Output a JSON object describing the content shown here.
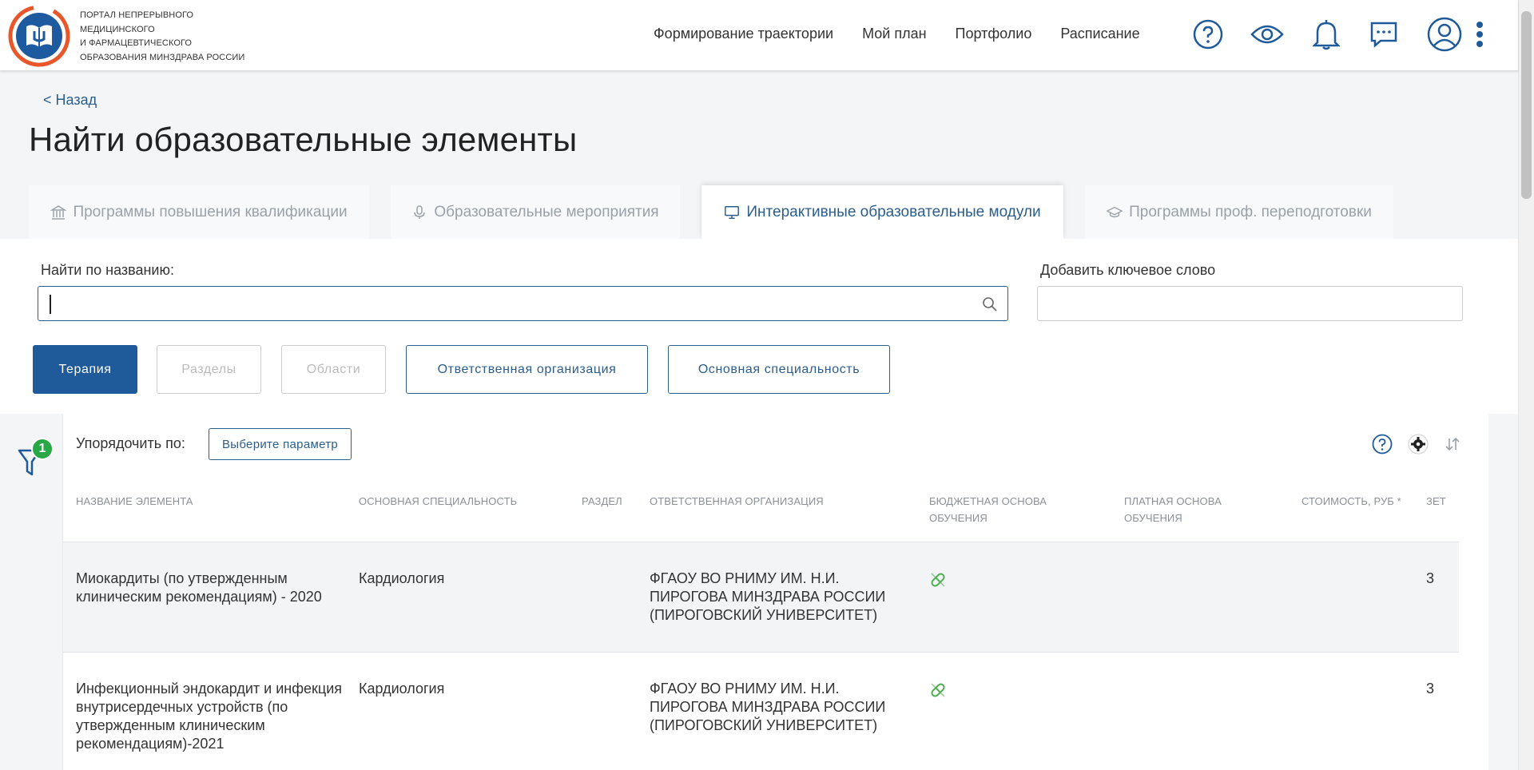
{
  "header": {
    "logo_text": [
      "ПОРТАЛ НЕПРЕРЫВНОГО",
      "МЕДИЦИНСКОГО",
      "И ФАРМАЦЕВТИЧЕСКОГО",
      "ОБРАЗОВАНИЯ МИНЗДРАВА РОССИИ"
    ],
    "nav": [
      "Формирование траектории",
      "Мой план",
      "Портфолио",
      "Расписание"
    ],
    "icons": [
      "help-icon",
      "eye-icon",
      "bell-icon",
      "chat-icon",
      "user-icon",
      "more-vertical-icon"
    ]
  },
  "page": {
    "back": "< Назад",
    "title": "Найти образовательные элементы"
  },
  "tabs": [
    {
      "label": "Программы повышения квалификации",
      "icon": "bank-icon"
    },
    {
      "label": "Образовательные мероприятия",
      "icon": "microphone-icon"
    },
    {
      "label": "Интерактивные образовательные модули",
      "icon": "monitor-icon",
      "active": true
    },
    {
      "label": "Программы проф. переподготовки",
      "icon": "graduation-cap-icon"
    }
  ],
  "filters": {
    "search_label": "Найти по названию:",
    "search_value": "",
    "keyword_label": "Добавить ключевое слово",
    "keyword_value": "",
    "chips": [
      "Терапия",
      "Разделы",
      "Области",
      "Ответственная организация",
      "Основная специальность"
    ]
  },
  "table": {
    "filter_count": "1",
    "sort_label": "Упорядочить по:",
    "sort_button": "Выберите параметр",
    "headers": [
      "НАЗВАНИЕ ЭЛЕМЕНТА",
      "ОСНОВНАЯ СПЕЦИАЛЬНОСТЬ",
      "РАЗДЕЛ",
      "ОТВЕТСТВЕННАЯ ОРГАНИЗАЦИЯ",
      "БЮДЖЕТНАЯ ОСНОВА ОБУЧЕНИЯ",
      "ПЛАТНАЯ ОСНОВА ОБУЧЕНИЯ",
      "СТОИМОСТЬ, РУБ *",
      "ЗЕТ"
    ],
    "rows": [
      {
        "name": "Миокардиты (по утвержденным клиническим рекомендациям) - 2020",
        "specialty": "Кардиология",
        "section": "",
        "org": "ФГАОУ ВО РНИМУ ИМ. Н.И. ПИРОГОВА МИНЗДРАВА РОССИИ (ПИРОГОВСКИЙ УНИВЕРСИТЕТ)",
        "budget": "pill-icon",
        "paid": "",
        "cost": "",
        "zet": "3"
      },
      {
        "name": "Инфекционный эндокардит и инфекция внутрисердечных устройств (по утвержденным клиническим рекомендациям)-2021",
        "specialty": "Кардиология",
        "section": "",
        "org": "ФГАОУ ВО РНИМУ ИМ. Н.И. ПИРОГОВА МИНЗДРАВА РОССИИ (ПИРОГОВСКИЙ УНИВЕРСИТЕТ)",
        "budget": "pill-icon",
        "paid": "",
        "cost": "",
        "zet": "3"
      }
    ]
  },
  "colors": {
    "primary": "#1f5b9b",
    "link": "#2c5e8c",
    "logo_orange": "#e8562a",
    "logo_blue": "#1e5aa0",
    "badge_green": "#28a745",
    "pill_green": "#4caf50"
  }
}
